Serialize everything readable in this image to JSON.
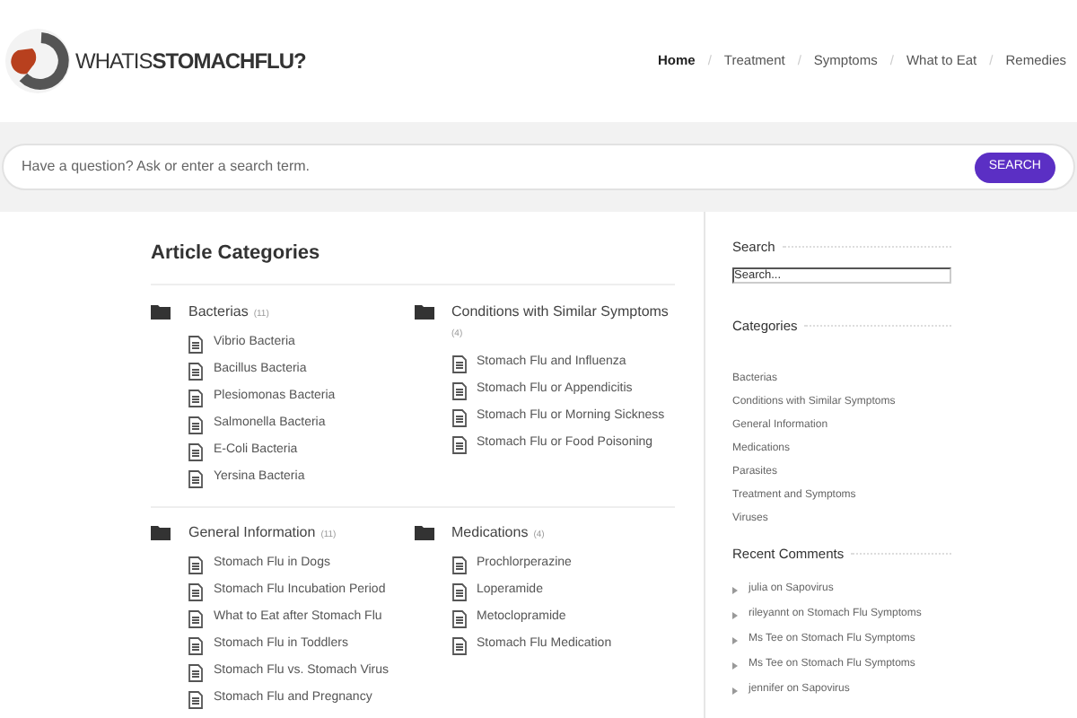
{
  "logo": {
    "text": "WHATIS**STOMACHFLU?**"
  },
  "nav": [
    {
      "label": "Home",
      "selected": true
    },
    {
      "label": "Treatment",
      "selected": false
    },
    {
      "label": "Symptoms",
      "selected": false
    },
    {
      "label": "What to Eat",
      "selected": false
    },
    {
      "label": "Remedies",
      "selected": false
    }
  ],
  "nav_separator": "/",
  "search_bar": {
    "placeholder": "Have a question? Ask or enter a search term.",
    "button": "SEARCH"
  },
  "main": {
    "title": "Article Categories",
    "sections": [
      [
        {
          "name": "Bacterias",
          "count": "(11)",
          "articles": [
            "Vibrio Bacteria",
            "Bacillus Bacteria",
            "Plesiomonas Bacteria",
            "Salmonella Bacteria",
            "E-Coli Bacteria",
            "Yersina Bacteria"
          ]
        },
        {
          "name": "Conditions with Similar Symptoms",
          "count": "(4)",
          "articles": [
            "Stomach Flu and Influenza",
            "Stomach Flu or Appendicitis",
            "Stomach Flu or Morning Sickness",
            "Stomach Flu or Food Poisoning"
          ]
        }
      ],
      [
        {
          "name": "General Information",
          "count": "(11)",
          "articles": [
            "Stomach Flu in Dogs",
            "Stomach Flu Incubation Period",
            "What to Eat after Stomach Flu",
            "Stomach Flu in Toddlers",
            "Stomach Flu vs. Stomach Virus",
            "Stomach Flu and Pregnancy"
          ]
        },
        {
          "name": "Medications",
          "count": "(4)",
          "articles": [
            "Prochlorperazine",
            "Loperamide",
            "Metoclopramide",
            "Stomach Flu Medication"
          ]
        }
      ]
    ]
  },
  "sidebar": {
    "search": {
      "title": "Search",
      "placeholder": "Search..."
    },
    "categories": {
      "title": "Categories",
      "items": [
        "Bacterias",
        "Conditions with Similar Symptoms",
        "General Information",
        "Medications",
        "Parasites",
        "Treatment and Symptoms",
        "Viruses"
      ]
    },
    "recent_comments": {
      "title": "Recent Comments",
      "items": [
        "julia on Sapovirus",
        "rileyannt on Stomach Flu Symptoms",
        "Ms Tee on Stomach Flu Symptoms",
        "Ms Tee on Stomach Flu Symptoms",
        "jennifer on Sapovirus"
      ]
    }
  }
}
